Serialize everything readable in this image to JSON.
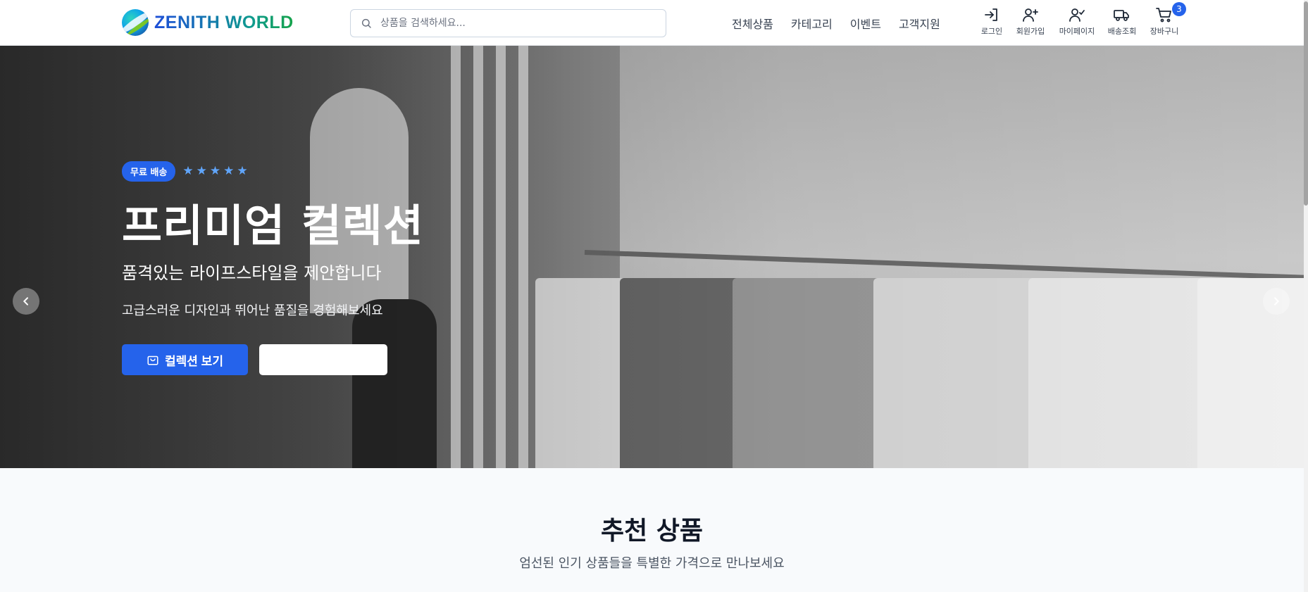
{
  "brand": {
    "name": "ZENITH WORLD"
  },
  "search": {
    "placeholder": "상품을 검색하세요..."
  },
  "nav": {
    "items": [
      "전체상품",
      "카테고리",
      "이벤트",
      "고객지원"
    ]
  },
  "actions": {
    "login": "로그인",
    "signup": "회원가입",
    "mypage": "마이페이지",
    "tracking": "배송조회",
    "cart": "장바구니",
    "cart_count": "3"
  },
  "hero": {
    "chip": "무료 배송",
    "stars": 5,
    "title": "프리미엄 컬렉션",
    "subtitle": "품격있는 라이프스타일을 제안합니다",
    "description": "고급스러운 디자인과 뛰어난 품질을 경험해보세요",
    "primary_button": "컬렉션 보기",
    "secondary_button": "",
    "slides": 3,
    "active_slide": 3
  },
  "recommended": {
    "title": "추천 상품",
    "subtitle": "엄선된 인기 상품들을 특별한 가격으로 만나보세요"
  },
  "colors": {
    "accent": "#2563eb",
    "star": "#60a5fa"
  }
}
